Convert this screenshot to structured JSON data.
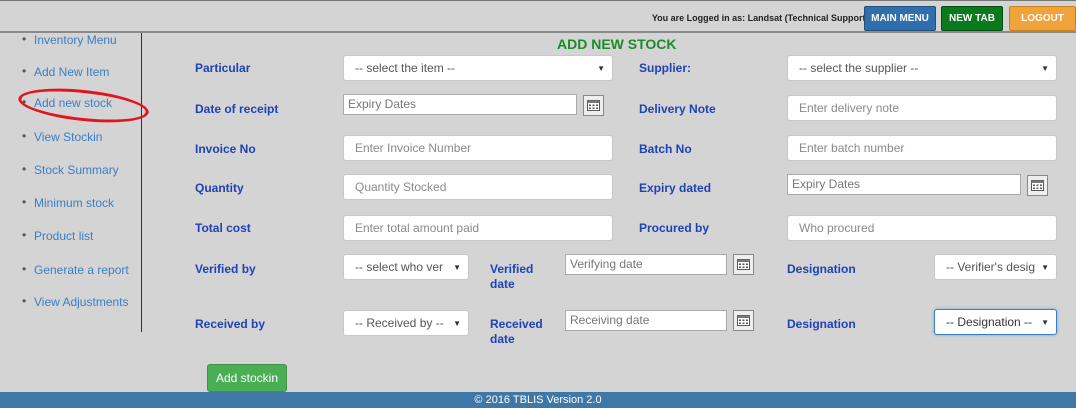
{
  "header": {
    "logged_in": "You are Logged in as: Landsat (Technical Support) (Administrator)",
    "main_menu": "MAIN MENU",
    "new_tab": "NEW TAB",
    "logout": "LOGOUT"
  },
  "sidebar": {
    "items": [
      {
        "label": "Inventory Menu"
      },
      {
        "label": "Add New Item"
      },
      {
        "label": "Add new stock"
      },
      {
        "label": "View Stockin"
      },
      {
        "label": "Stock Summary"
      },
      {
        "label": "Minimum stock"
      },
      {
        "label": "Product list"
      },
      {
        "label": "Generate a report"
      },
      {
        "label": "View Adjustments"
      }
    ]
  },
  "form": {
    "title": "ADD NEW STOCK",
    "particular": {
      "label": "Particular",
      "value": "-- select the item --"
    },
    "supplier": {
      "label": "Supplier:",
      "value": "-- select the supplier --"
    },
    "date_of_receipt": {
      "label": "Date of receipt",
      "value": "Expiry Dates"
    },
    "delivery_note": {
      "label": "Delivery Note",
      "placeholder": "Enter delivery note"
    },
    "invoice_no": {
      "label": "Invoice No",
      "placeholder": "Enter Invoice Number"
    },
    "batch_no": {
      "label": "Batch No",
      "placeholder": "Enter batch number"
    },
    "quantity": {
      "label": "Quantity",
      "placeholder": "Quantity Stocked"
    },
    "expiry_dated": {
      "label": "Expiry dated",
      "value": "Expiry Dates"
    },
    "total_cost": {
      "label": "Total cost",
      "placeholder": "Enter total amount paid"
    },
    "procured_by": {
      "label": "Procured by",
      "placeholder": "Who procured"
    },
    "verified_by": {
      "label": "Verified by",
      "value": "-- select who ver"
    },
    "verified_date": {
      "label": "Verified date",
      "value": "Verifying date"
    },
    "designation_1": {
      "label": "Designation",
      "value": "-- Verifier's desig"
    },
    "received_by": {
      "label": "Received by",
      "value": "-- Received by --"
    },
    "received_date": {
      "label": "Received date",
      "value": "Receiving date"
    },
    "designation_2": {
      "label": "Designation",
      "value": "-- Designation --"
    },
    "submit": "Add stockin"
  },
  "footer": {
    "text": "© 2016 TBLIS Version 2.0"
  },
  "colors": {
    "label": "#1f42b5",
    "title": "#1a8c2a",
    "link": "#3a7fc4",
    "footer": "#3f78a7"
  }
}
